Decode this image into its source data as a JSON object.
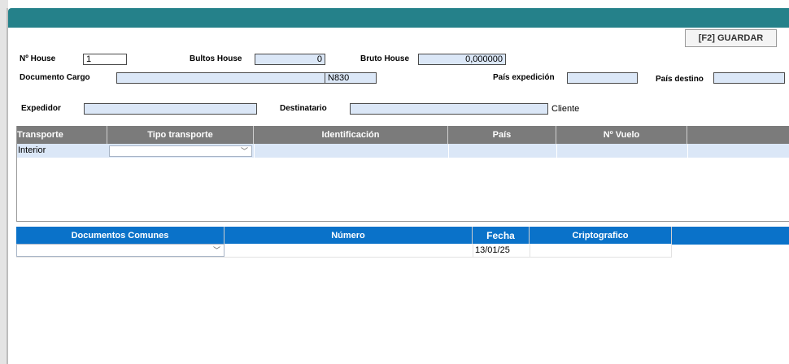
{
  "toolbar": {
    "save_label": "[F2] GUARDAR"
  },
  "header": {
    "house_label": "Nº House",
    "house_value": "1",
    "bultos_label": "Bultos House",
    "bultos_value": "0",
    "bruto_label": "Bruto House",
    "bruto_value": "0,000000",
    "doc_cargo_label": "Documento Cargo",
    "doc_cargo_value": "",
    "doc_cargo_code": "N830",
    "pais_exped_label": "País expedición",
    "pais_exped_value": "",
    "pais_dest_label": "País destino",
    "pais_dest_value": "",
    "expedidor_label": "Expedidor",
    "expedidor_value": "",
    "destinatario_label": "Destinatario",
    "destinatario_value": "",
    "cliente_label": "Cliente"
  },
  "transport_grid": {
    "columns": [
      "Transporte",
      "Tipo transporte",
      "Identificación",
      "País",
      "Nº Vuelo",
      ""
    ],
    "rows": [
      {
        "transporte": "Interior",
        "tipo": "",
        "identificacion": "",
        "pais": "",
        "vuelo": ""
      }
    ]
  },
  "documents_grid": {
    "columns": [
      "Documentos Comunes",
      "Número",
      "Fecha",
      "Criptografico",
      ""
    ],
    "rows": [
      {
        "documento": "",
        "numero": "",
        "fecha": "13/01/25",
        "cripto": ""
      }
    ]
  },
  "icons": {
    "dropdown": "chevron-down-icon"
  },
  "colors": {
    "title_bar": "#25818a",
    "transport_header": "#7b7b7b",
    "documents_header": "#0a72c9",
    "input_fill": "#dbe7f7"
  }
}
